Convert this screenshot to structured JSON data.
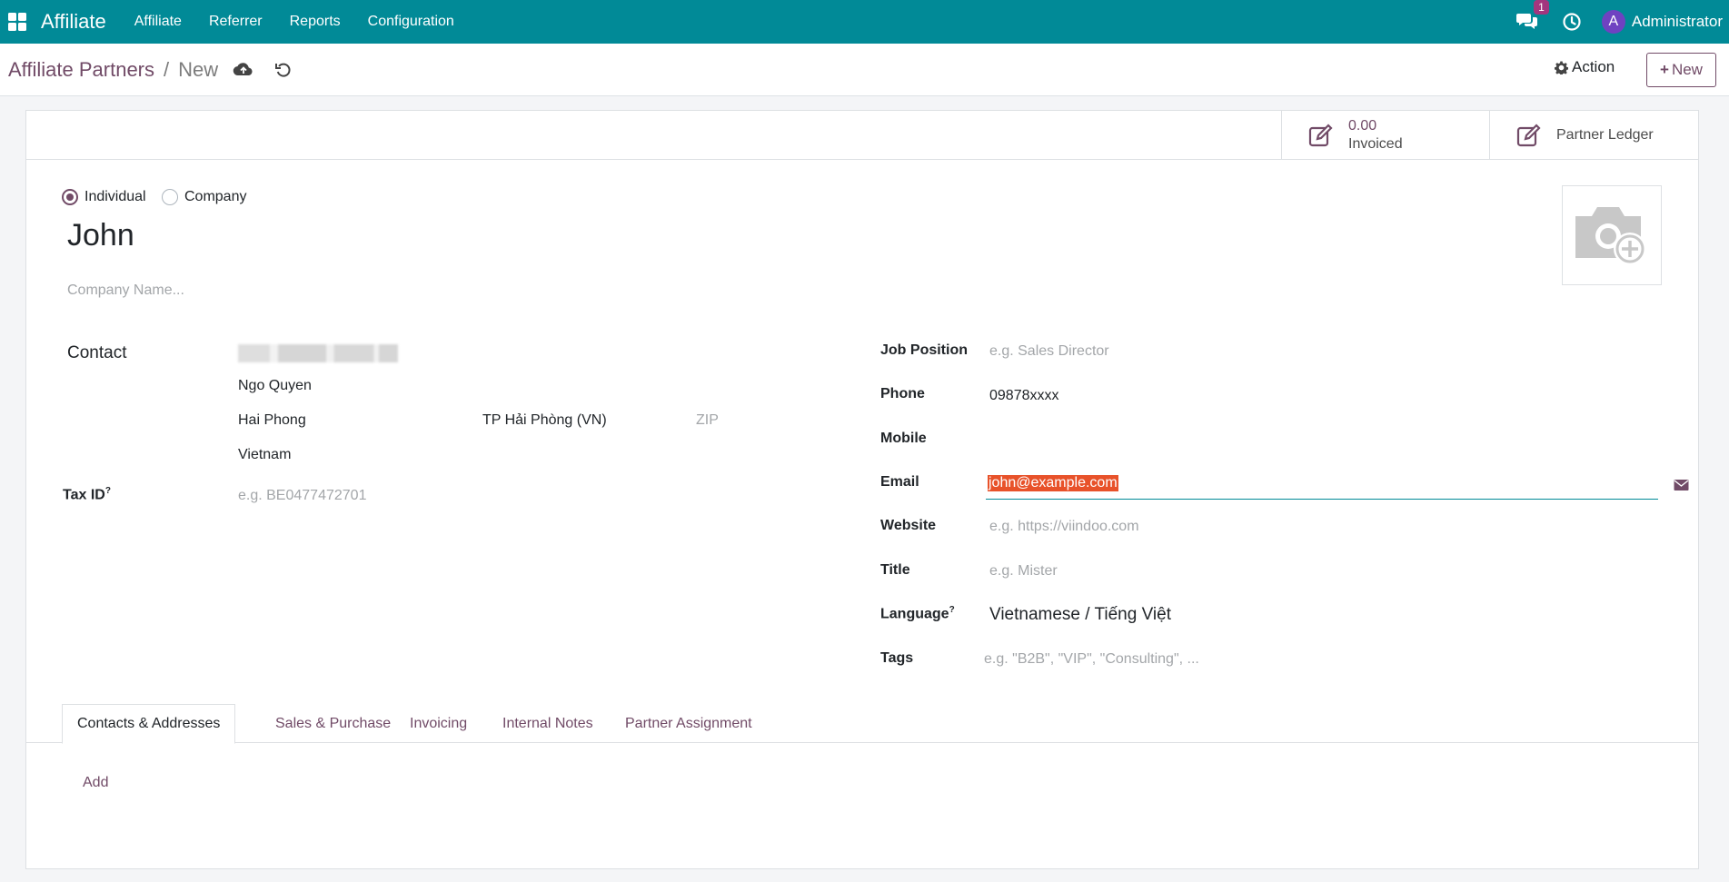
{
  "navbar": {
    "brand": "Affiliate",
    "menu": [
      "Affiliate",
      "Referrer",
      "Reports",
      "Configuration"
    ],
    "chat_badge": "1",
    "user_initial": "A",
    "user_name": "Administrator"
  },
  "control": {
    "breadcrumb_parent": "Affiliate Partners",
    "breadcrumb_sep": "/",
    "breadcrumb_current": "New",
    "action_label": "Action",
    "new_label": "New"
  },
  "stats": {
    "invoiced_value": "0.00",
    "invoiced_label": "Invoiced",
    "ledger_label": "Partner Ledger"
  },
  "form": {
    "type_options": [
      "Individual",
      "Company"
    ],
    "type_selected": "Individual",
    "name": "John",
    "company_name_placeholder": "Company Name...",
    "contact_label": "Contact",
    "street2": "Ngo Quyen",
    "city": "Hai Phong",
    "state": "TP Hải Phòng (VN)",
    "zip_placeholder": "ZIP",
    "country": "Vietnam",
    "tax_id_label": "Tax ID",
    "tax_id_placeholder": "e.g. BE0477472701",
    "help_mark": "?",
    "job_position_label": "Job Position",
    "job_position_placeholder": "e.g. Sales Director",
    "phone_label": "Phone",
    "phone_value": "09878xxxx",
    "mobile_label": "Mobile",
    "email_label": "Email",
    "email_value": "john@example.com",
    "website_label": "Website",
    "website_placeholder": "e.g. https://viindoo.com",
    "title_label": "Title",
    "title_placeholder": "e.g. Mister",
    "language_label": "Language",
    "language_value": "Vietnamese / Tiếng Việt",
    "tags_label": "Tags",
    "tags_placeholder": "e.g. \"B2B\", \"VIP\", \"Consulting\", ..."
  },
  "tabs": [
    "Contacts & Addresses",
    "Sales & Purchase",
    "Invoicing",
    "Internal Notes",
    "Partner Assignment"
  ],
  "tab_active": "Contacts & Addresses",
  "add_label": "Add",
  "colors": {
    "navbar": "#018a97",
    "accent": "#714b67",
    "selection": "#e8522a"
  }
}
